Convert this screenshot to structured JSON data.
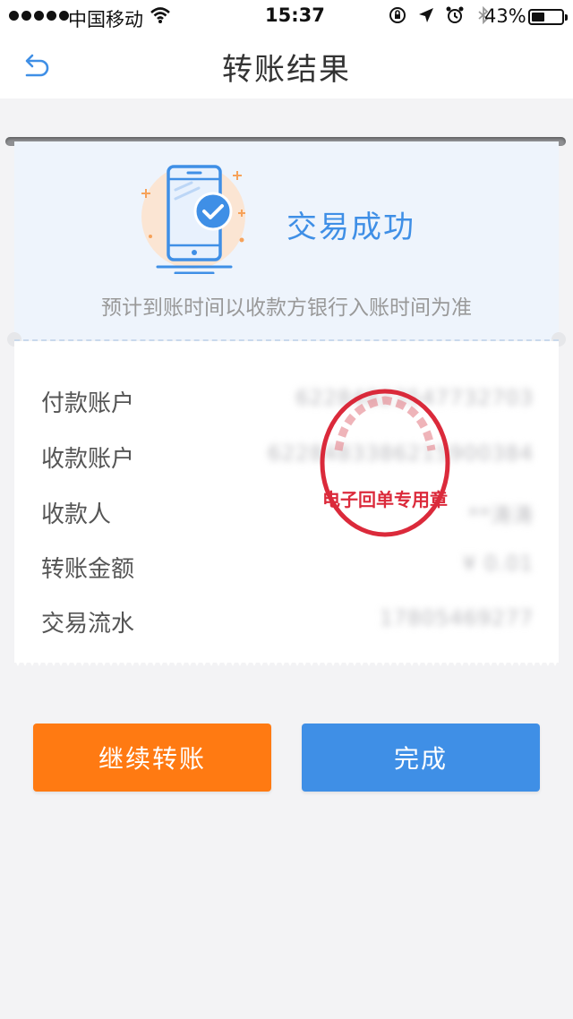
{
  "status_bar": {
    "carrier": "中国移动",
    "time": "15:37",
    "battery_percent": "43%",
    "battery_level": 0.43,
    "icons": [
      "signal-dots-icon",
      "wifi-icon",
      "orientation-lock-icon",
      "location-arrow-icon",
      "alarm-icon",
      "bluetooth-icon",
      "battery-icon"
    ]
  },
  "header": {
    "title": "转账结果",
    "back_icon": "back-arrow-icon"
  },
  "result": {
    "status": "交易成功",
    "notice": "预计到账时间以收款方银行入账时间为准",
    "illustration_icon": "phone-check-icon"
  },
  "details": {
    "rows": [
      {
        "label": "付款账户",
        "value": "62284823547732703"
      },
      {
        "label": "收款账户",
        "value": "6228483386215900384"
      },
      {
        "label": "收款人",
        "value": "**涛涛"
      },
      {
        "label": "转账金额",
        "value": "¥ 0.01"
      },
      {
        "label": "交易流水",
        "value": "17805469277"
      }
    ],
    "stamp_text": "电子回单专用章"
  },
  "actions": {
    "continue_label": "继续转账",
    "done_label": "完成"
  },
  "colors": {
    "accent_blue": "#3f8fe6",
    "accent_orange": "#ff7a12",
    "stamp_red": "#d8192b",
    "header_bg": "#ffffff",
    "receipt_top_bg": "#eef4fc",
    "page_bg": "#f3f3f5"
  }
}
